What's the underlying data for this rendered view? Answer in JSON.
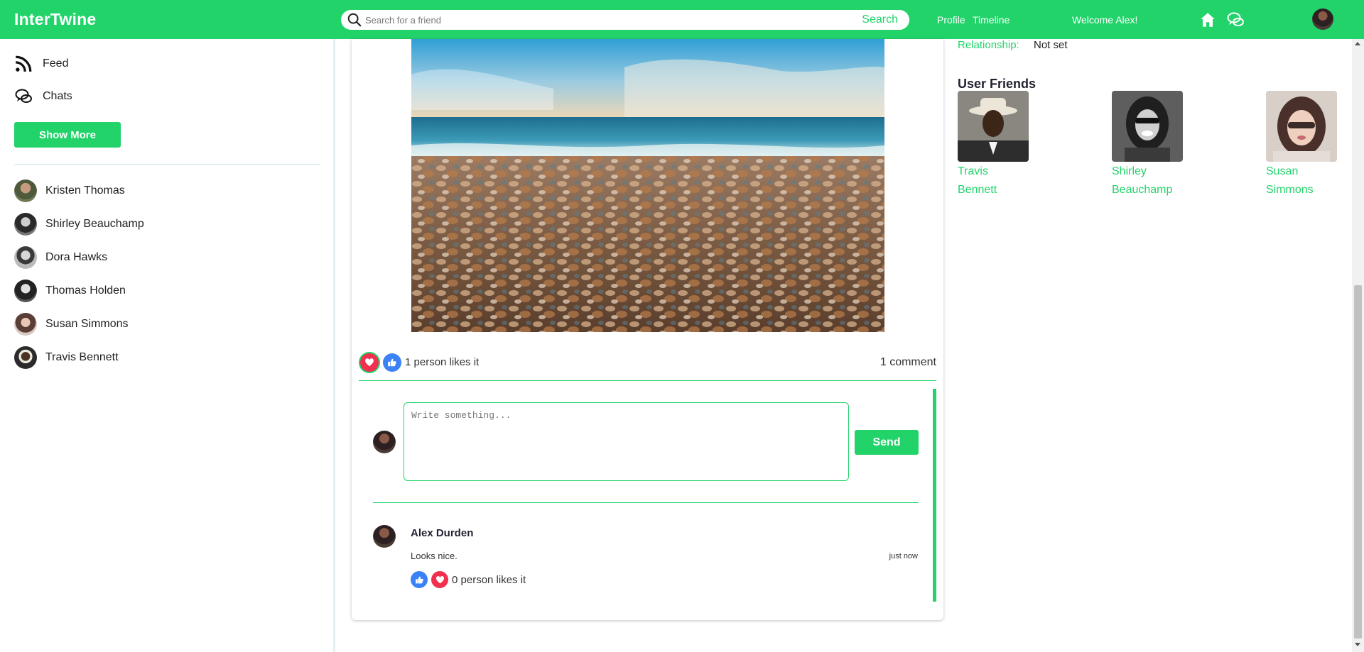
{
  "header": {
    "logo": "InterTwine",
    "search_placeholder": "Search for a friend",
    "search_button": "Search",
    "profile_link": "Profile",
    "timeline_link": "Timeline",
    "welcome": "Welcome Alex!"
  },
  "sidebar": {
    "nav": [
      {
        "label": "Feed",
        "icon": "rss-icon"
      },
      {
        "label": "Chats",
        "icon": "chat-icon"
      }
    ],
    "show_more": "Show More",
    "friends": [
      {
        "name": "Kristen Thomas"
      },
      {
        "name": "Shirley Beauchamp"
      },
      {
        "name": "Dora Hawks"
      },
      {
        "name": "Thomas Holden"
      },
      {
        "name": "Susan Simmons"
      },
      {
        "name": "Travis Bennett"
      }
    ]
  },
  "post": {
    "likes_text": "1 person likes it",
    "comments_text": "1 comment",
    "comment_placeholder": "Write something...",
    "send_label": "Send",
    "comment": {
      "author": "Alex Durden",
      "text": "Looks nice.",
      "time": "just now",
      "likes_text": "0 person likes it"
    }
  },
  "profile": {
    "relationship_label": "Relationship:",
    "relationship_value": "Not set",
    "friends_title": "User Friends",
    "friends": [
      {
        "first": "Travis",
        "last": "Bennett"
      },
      {
        "first": "Shirley",
        "last": "Beauchamp"
      },
      {
        "first": "Susan",
        "last": "Simmons"
      }
    ]
  },
  "colors": {
    "accent": "#22d36a",
    "like_blue": "#3b82f6",
    "heart_red": "#f0304e"
  }
}
